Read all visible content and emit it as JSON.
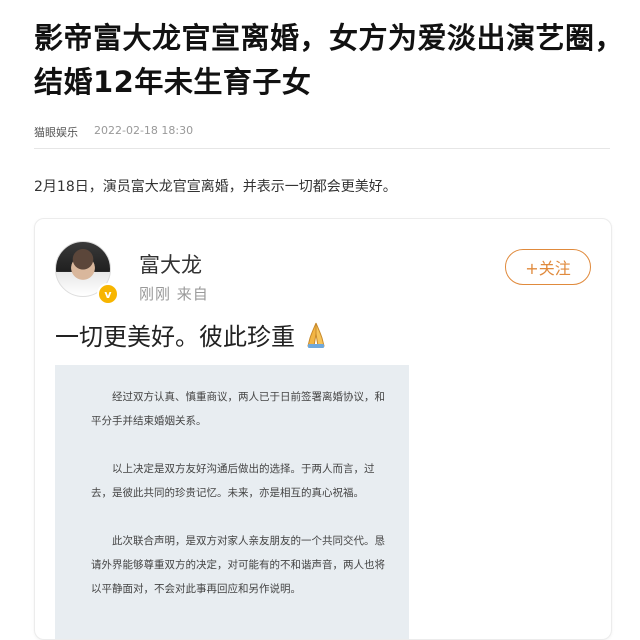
{
  "article": {
    "title": "影帝富大龙官宣离婚，女方为爱淡出演艺圈，结婚12年未生育子女",
    "source": "猫眼娱乐",
    "time": "2022-02-18 18:30",
    "lead": "2月18日，演员富大龙官宣离婚，并表示一切都会更美好。"
  },
  "weibo": {
    "username": "富大龙",
    "subline": "刚刚  来自",
    "follow_label": "+关注",
    "verified_badge": "v",
    "post_text": "一切更美好。彼此珍重",
    "post_emoji": "pray-icon",
    "statement_paragraphs": [
      "经过双方认真、慎重商议，两人已于日前签署离婚协议，和平分手并结束婚姻关系。",
      "以上决定是双方友好沟通后做出的选择。于两人而言，过去，是彼此共同的珍贵记忆。未来，亦是相互的真心祝福。",
      "此次联合声明，是双方对家人亲友朋友的一个共同交代。恳请外界能够尊重双方的决定，对可能有的不和谐声音，两人也将以平静面对，不会对此事再回应和另作说明。"
    ]
  },
  "colors": {
    "follow_accent": "#e08a3c",
    "verified": "#f7b500",
    "statement_bg": "#e8edf1"
  }
}
